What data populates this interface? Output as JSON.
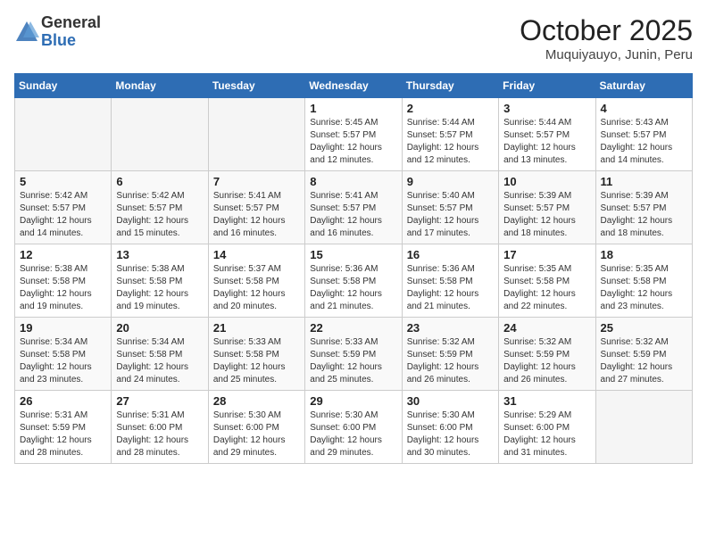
{
  "logo": {
    "general": "General",
    "blue": "Blue"
  },
  "title": "October 2025",
  "location": "Muquiyauyo, Junin, Peru",
  "days_of_week": [
    "Sunday",
    "Monday",
    "Tuesday",
    "Wednesday",
    "Thursday",
    "Friday",
    "Saturday"
  ],
  "weeks": [
    [
      {
        "day": "",
        "empty": true
      },
      {
        "day": "",
        "empty": true
      },
      {
        "day": "",
        "empty": true
      },
      {
        "day": "1",
        "sunrise": "Sunrise: 5:45 AM",
        "sunset": "Sunset: 5:57 PM",
        "daylight": "Daylight: 12 hours and 12 minutes."
      },
      {
        "day": "2",
        "sunrise": "Sunrise: 5:44 AM",
        "sunset": "Sunset: 5:57 PM",
        "daylight": "Daylight: 12 hours and 12 minutes."
      },
      {
        "day": "3",
        "sunrise": "Sunrise: 5:44 AM",
        "sunset": "Sunset: 5:57 PM",
        "daylight": "Daylight: 12 hours and 13 minutes."
      },
      {
        "day": "4",
        "sunrise": "Sunrise: 5:43 AM",
        "sunset": "Sunset: 5:57 PM",
        "daylight": "Daylight: 12 hours and 14 minutes."
      }
    ],
    [
      {
        "day": "5",
        "sunrise": "Sunrise: 5:42 AM",
        "sunset": "Sunset: 5:57 PM",
        "daylight": "Daylight: 12 hours and 14 minutes."
      },
      {
        "day": "6",
        "sunrise": "Sunrise: 5:42 AM",
        "sunset": "Sunset: 5:57 PM",
        "daylight": "Daylight: 12 hours and 15 minutes."
      },
      {
        "day": "7",
        "sunrise": "Sunrise: 5:41 AM",
        "sunset": "Sunset: 5:57 PM",
        "daylight": "Daylight: 12 hours and 16 minutes."
      },
      {
        "day": "8",
        "sunrise": "Sunrise: 5:41 AM",
        "sunset": "Sunset: 5:57 PM",
        "daylight": "Daylight: 12 hours and 16 minutes."
      },
      {
        "day": "9",
        "sunrise": "Sunrise: 5:40 AM",
        "sunset": "Sunset: 5:57 PM",
        "daylight": "Daylight: 12 hours and 17 minutes."
      },
      {
        "day": "10",
        "sunrise": "Sunrise: 5:39 AM",
        "sunset": "Sunset: 5:57 PM",
        "daylight": "Daylight: 12 hours and 18 minutes."
      },
      {
        "day": "11",
        "sunrise": "Sunrise: 5:39 AM",
        "sunset": "Sunset: 5:57 PM",
        "daylight": "Daylight: 12 hours and 18 minutes."
      }
    ],
    [
      {
        "day": "12",
        "sunrise": "Sunrise: 5:38 AM",
        "sunset": "Sunset: 5:58 PM",
        "daylight": "Daylight: 12 hours and 19 minutes."
      },
      {
        "day": "13",
        "sunrise": "Sunrise: 5:38 AM",
        "sunset": "Sunset: 5:58 PM",
        "daylight": "Daylight: 12 hours and 19 minutes."
      },
      {
        "day": "14",
        "sunrise": "Sunrise: 5:37 AM",
        "sunset": "Sunset: 5:58 PM",
        "daylight": "Daylight: 12 hours and 20 minutes."
      },
      {
        "day": "15",
        "sunrise": "Sunrise: 5:36 AM",
        "sunset": "Sunset: 5:58 PM",
        "daylight": "Daylight: 12 hours and 21 minutes."
      },
      {
        "day": "16",
        "sunrise": "Sunrise: 5:36 AM",
        "sunset": "Sunset: 5:58 PM",
        "daylight": "Daylight: 12 hours and 21 minutes."
      },
      {
        "day": "17",
        "sunrise": "Sunrise: 5:35 AM",
        "sunset": "Sunset: 5:58 PM",
        "daylight": "Daylight: 12 hours and 22 minutes."
      },
      {
        "day": "18",
        "sunrise": "Sunrise: 5:35 AM",
        "sunset": "Sunset: 5:58 PM",
        "daylight": "Daylight: 12 hours and 23 minutes."
      }
    ],
    [
      {
        "day": "19",
        "sunrise": "Sunrise: 5:34 AM",
        "sunset": "Sunset: 5:58 PM",
        "daylight": "Daylight: 12 hours and 23 minutes."
      },
      {
        "day": "20",
        "sunrise": "Sunrise: 5:34 AM",
        "sunset": "Sunset: 5:58 PM",
        "daylight": "Daylight: 12 hours and 24 minutes."
      },
      {
        "day": "21",
        "sunrise": "Sunrise: 5:33 AM",
        "sunset": "Sunset: 5:58 PM",
        "daylight": "Daylight: 12 hours and 25 minutes."
      },
      {
        "day": "22",
        "sunrise": "Sunrise: 5:33 AM",
        "sunset": "Sunset: 5:59 PM",
        "daylight": "Daylight: 12 hours and 25 minutes."
      },
      {
        "day": "23",
        "sunrise": "Sunrise: 5:32 AM",
        "sunset": "Sunset: 5:59 PM",
        "daylight": "Daylight: 12 hours and 26 minutes."
      },
      {
        "day": "24",
        "sunrise": "Sunrise: 5:32 AM",
        "sunset": "Sunset: 5:59 PM",
        "daylight": "Daylight: 12 hours and 26 minutes."
      },
      {
        "day": "25",
        "sunrise": "Sunrise: 5:32 AM",
        "sunset": "Sunset: 5:59 PM",
        "daylight": "Daylight: 12 hours and 27 minutes."
      }
    ],
    [
      {
        "day": "26",
        "sunrise": "Sunrise: 5:31 AM",
        "sunset": "Sunset: 5:59 PM",
        "daylight": "Daylight: 12 hours and 28 minutes."
      },
      {
        "day": "27",
        "sunrise": "Sunrise: 5:31 AM",
        "sunset": "Sunset: 6:00 PM",
        "daylight": "Daylight: 12 hours and 28 minutes."
      },
      {
        "day": "28",
        "sunrise": "Sunrise: 5:30 AM",
        "sunset": "Sunset: 6:00 PM",
        "daylight": "Daylight: 12 hours and 29 minutes."
      },
      {
        "day": "29",
        "sunrise": "Sunrise: 5:30 AM",
        "sunset": "Sunset: 6:00 PM",
        "daylight": "Daylight: 12 hours and 29 minutes."
      },
      {
        "day": "30",
        "sunrise": "Sunrise: 5:30 AM",
        "sunset": "Sunset: 6:00 PM",
        "daylight": "Daylight: 12 hours and 30 minutes."
      },
      {
        "day": "31",
        "sunrise": "Sunrise: 5:29 AM",
        "sunset": "Sunset: 6:00 PM",
        "daylight": "Daylight: 12 hours and 31 minutes."
      },
      {
        "day": "",
        "empty": true
      }
    ]
  ]
}
